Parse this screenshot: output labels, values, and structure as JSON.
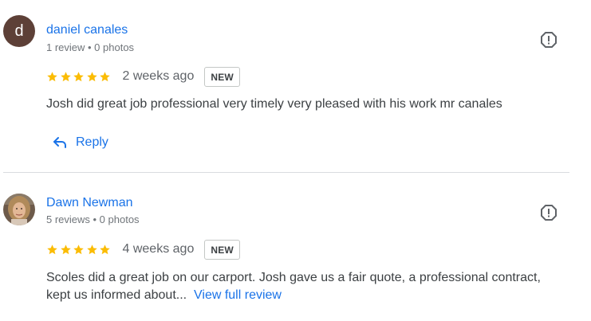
{
  "colors": {
    "link": "#1a73e8",
    "star": "#fbbc04",
    "divider": "#dadce0",
    "avatar_letter_bg": "#5d4037"
  },
  "reviews": [
    {
      "avatar_letter": "d",
      "author": "daniel canales",
      "meta": "1 review • 0 photos",
      "rating": 5,
      "time": "2 weeks ago",
      "badge": "NEW",
      "text": "Josh did great job professional very timely very pleased with his work mr canales",
      "reply_label": "Reply",
      "flag_icon": "report-flag-icon"
    },
    {
      "avatar_image": "user-photo",
      "author": "Dawn Newman",
      "meta": "5 reviews • 0 photos",
      "rating": 5,
      "time": "4 weeks ago",
      "badge": "NEW",
      "text": "Scoles did a great job on our carport. Josh gave us a fair quote, a professional contract, kept us informed about...",
      "more_link": "View full review",
      "flag_icon": "report-flag-icon"
    }
  ]
}
